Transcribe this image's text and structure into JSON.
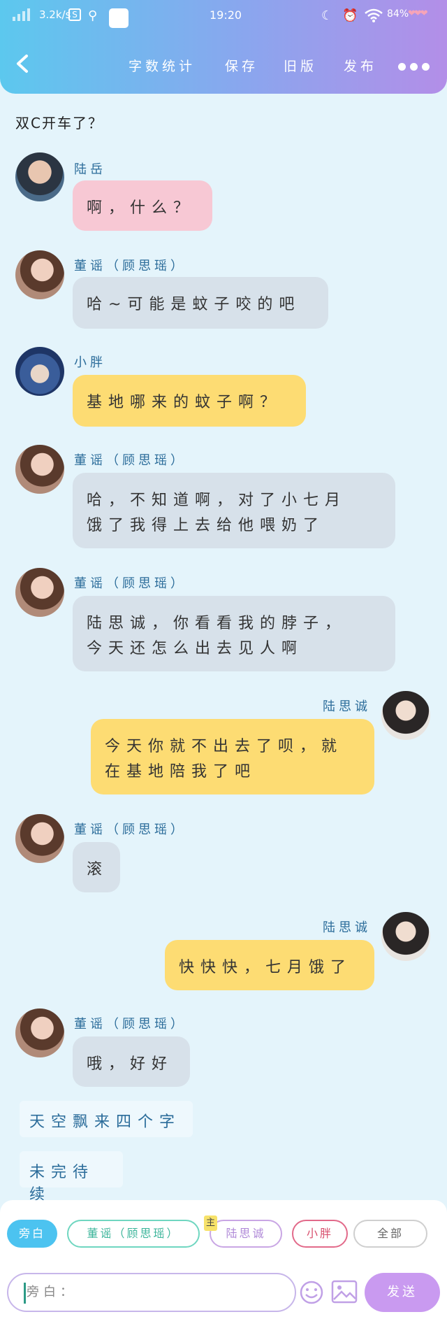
{
  "status_bar": {
    "speed": "3.2k/s",
    "s_badge": "S",
    "time": "19:20",
    "battery": "84%"
  },
  "nav": {
    "word_count": "字数统计",
    "save": "保存",
    "old_version": "旧版",
    "publish": "发布"
  },
  "chat_title": "双C开车了？",
  "messages": [
    {
      "sender": "陆岳",
      "text": "啊，什么？"
    },
    {
      "sender": "董谣（顾思瑶）",
      "text": "哈~可能是蚊子咬的吧"
    },
    {
      "sender": "小胖",
      "text": "基地哪来的蚊子啊？"
    },
    {
      "sender": "董谣（顾思瑶）",
      "line1": "哈，不知道啊，对了小七月",
      "line2": "饿了我得上去给他喂奶了"
    },
    {
      "sender": "董谣（顾思瑶）",
      "line1": "陆思诚，你看看我的脖子，",
      "line2": "今天还怎么出去见人啊"
    },
    {
      "sender": "陆思诚",
      "line1": "今天你就不出去了呗，就",
      "line2": "在基地陪我了吧"
    },
    {
      "sender": "董谣（顾思瑶）",
      "text": "滚"
    },
    {
      "sender": "陆思诚",
      "text": "快快快，七月饿了"
    },
    {
      "sender": "董谣（顾思瑶）",
      "text": "哦，好好"
    }
  ],
  "notes": [
    "天空飘来四个字",
    "未完待续"
  ],
  "bottom": {
    "tabs": {
      "narration": "旁白",
      "tong": "董谣（顾思瑶）",
      "lu": "陆思诚",
      "lu_badge": "主",
      "xiao": "小胖",
      "all": "全部"
    },
    "input_placeholder": "旁白：",
    "send": "发送"
  }
}
